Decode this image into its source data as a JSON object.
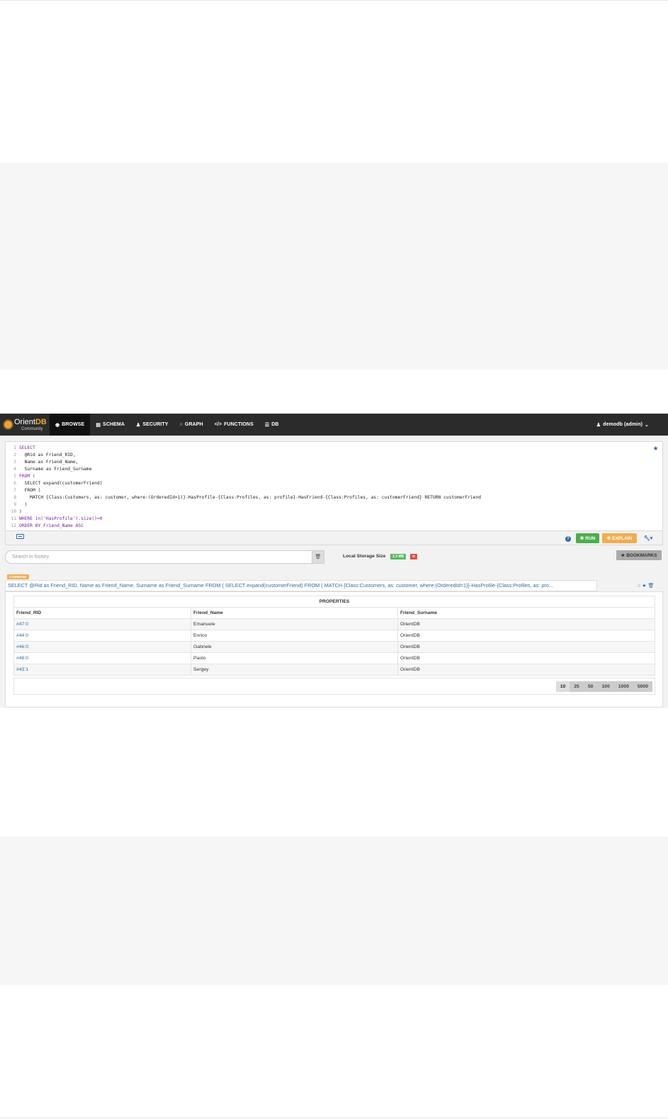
{
  "nav": {
    "logo_main_prefix": "Orient",
    "logo_main_bold": "DB",
    "logo_sub": "Community",
    "items": [
      {
        "label": "BROWSE",
        "icon": "eye-icon"
      },
      {
        "label": "SCHEMA",
        "icon": "table-icon"
      },
      {
        "label": "SECURITY",
        "icon": "user-icon"
      },
      {
        "label": "GRAPH",
        "icon": "circle-icon"
      },
      {
        "label": "FUNCTIONS",
        "icon": "code-icon"
      },
      {
        "label": "DB",
        "icon": "database-icon"
      }
    ],
    "user": "demodb (admin)"
  },
  "editor": {
    "lines": [
      {
        "num": "1",
        "text": "SELECT"
      },
      {
        "num": "2",
        "text": "  @Rid as Friend_RID,"
      },
      {
        "num": "3",
        "text": "  Name as Friend_Name,"
      },
      {
        "num": "4",
        "text": "  Surname as Friend_Surname"
      },
      {
        "num": "5",
        "text": "FROM ("
      },
      {
        "num": "6",
        "text": "  SELECT expand(customerFriend)"
      },
      {
        "num": "7",
        "text": "  FROM ("
      },
      {
        "num": "8",
        "text": "    MATCH {Class:Customers, as: customer, where:(OrderedId=1)}-HasProfile-{Class:Profiles, as: profile}-HasFriend-{Class:Profiles, as: customerFriend} RETURN customerFriend"
      },
      {
        "num": "9",
        "text": "  )"
      },
      {
        "num": "10",
        "text": ")"
      },
      {
        "num": "11",
        "text": "WHERE in('HasProfile').size()=0"
      },
      {
        "num": "12",
        "text": "ORDER BY Friend_Name ASC"
      }
    ]
  },
  "toolbar": {
    "help": "?",
    "run_label": "RUN",
    "explain_label": "EXPLAIN",
    "wrench_label": "▾"
  },
  "history": {
    "search_placeholder": "Search in history",
    "storage_label": "Local Storage Size",
    "storage_size": "1.3 MB",
    "bookmarks_label": "BOOKMARKS"
  },
  "result": {
    "command_badge": "COMMAND",
    "query_text": "SELECT @Rid as Friend_RID, Name as Friend_Name, Surname as Friend_Surname FROM ( SELECT expand(customerFriend) FROM ( MATCH {Class:Customers, as: customer, where:(OrderedId=1)}-HasProfile-{Class:Profiles, as: pro...",
    "properties_header": "PROPERTIES",
    "columns": [
      "Friend_RID",
      "Friend_Name",
      "Friend_Surname"
    ],
    "rows": [
      [
        "#47:0",
        "Emanuele",
        "OrientDB"
      ],
      [
        "#44:0",
        "Enrico",
        "OrientDB"
      ],
      [
        "#46:0",
        "Gabriele",
        "OrientDB"
      ],
      [
        "#48:0",
        "Paolo",
        "OrientDB"
      ],
      [
        "#43:1",
        "Sergey",
        "OrientDB"
      ]
    ],
    "page_sizes": [
      "10",
      "25",
      "50",
      "100",
      "1000",
      "5000"
    ],
    "selected_page_size": "10"
  },
  "colors": {
    "navbar": "#2b2b2b",
    "run": "#4cae4c",
    "explain": "#f0ad4e",
    "link": "#2e6da4"
  }
}
